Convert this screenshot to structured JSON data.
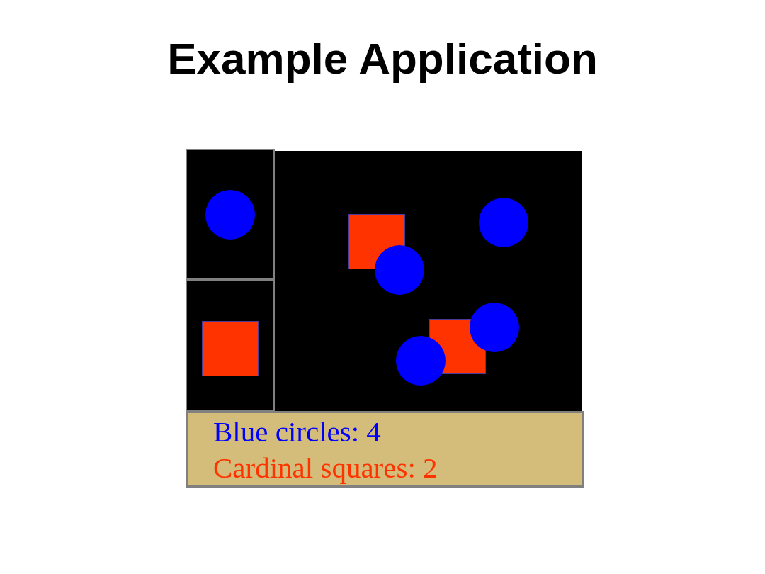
{
  "title": "Example Application",
  "palette": [
    {
      "kind": "circle",
      "color": "#0000ff"
    },
    {
      "kind": "square",
      "color": "#ff3300"
    }
  ],
  "canvas": {
    "shapes": [
      {
        "kind": "square",
        "color": "#ff3300"
      },
      {
        "kind": "circle",
        "color": "#0000ff"
      },
      {
        "kind": "circle",
        "color": "#0000ff"
      },
      {
        "kind": "square",
        "color": "#ff3300"
      },
      {
        "kind": "circle",
        "color": "#0000ff"
      },
      {
        "kind": "circle",
        "color": "#0000ff"
      }
    ]
  },
  "status": [
    {
      "text": "Blue circles: 4",
      "color": "#0000ff"
    },
    {
      "text": "Cardinal squares: 2",
      "color": "#ff3300"
    }
  ]
}
